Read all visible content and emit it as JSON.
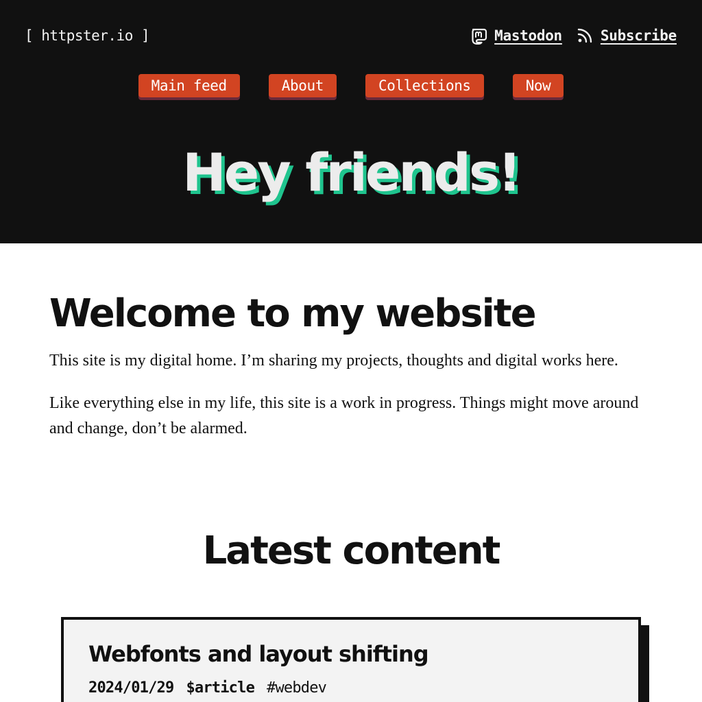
{
  "header": {
    "logo": "[ httpster.io ]",
    "links": [
      {
        "label": "Mastodon",
        "icon": "mastodon-icon"
      },
      {
        "label": "Subscribe",
        "icon": "rss-icon"
      }
    ],
    "nav": [
      "Main feed",
      "About",
      "Collections",
      "Now"
    ],
    "hero_title": "Hey friends!"
  },
  "main": {
    "title": "Welcome to my website",
    "paragraphs": [
      "This site is my digital home. I’m sharing my projects, thoughts and digital works here.",
      "Like everything else in my life, this site is a work in progress. Things might move around and change, don’t be alarmed."
    ],
    "latest_title": "Latest content",
    "posts": [
      {
        "title": "Webfonts and layout shifting",
        "date": "2024/01/29",
        "type": "$article",
        "tag": "#webdev"
      }
    ]
  },
  "colors": {
    "header_bg": "#111111",
    "nav_button": "#d24422",
    "hero_shadow": "#1fc48e",
    "card_bg": "#f3f3f3"
  }
}
